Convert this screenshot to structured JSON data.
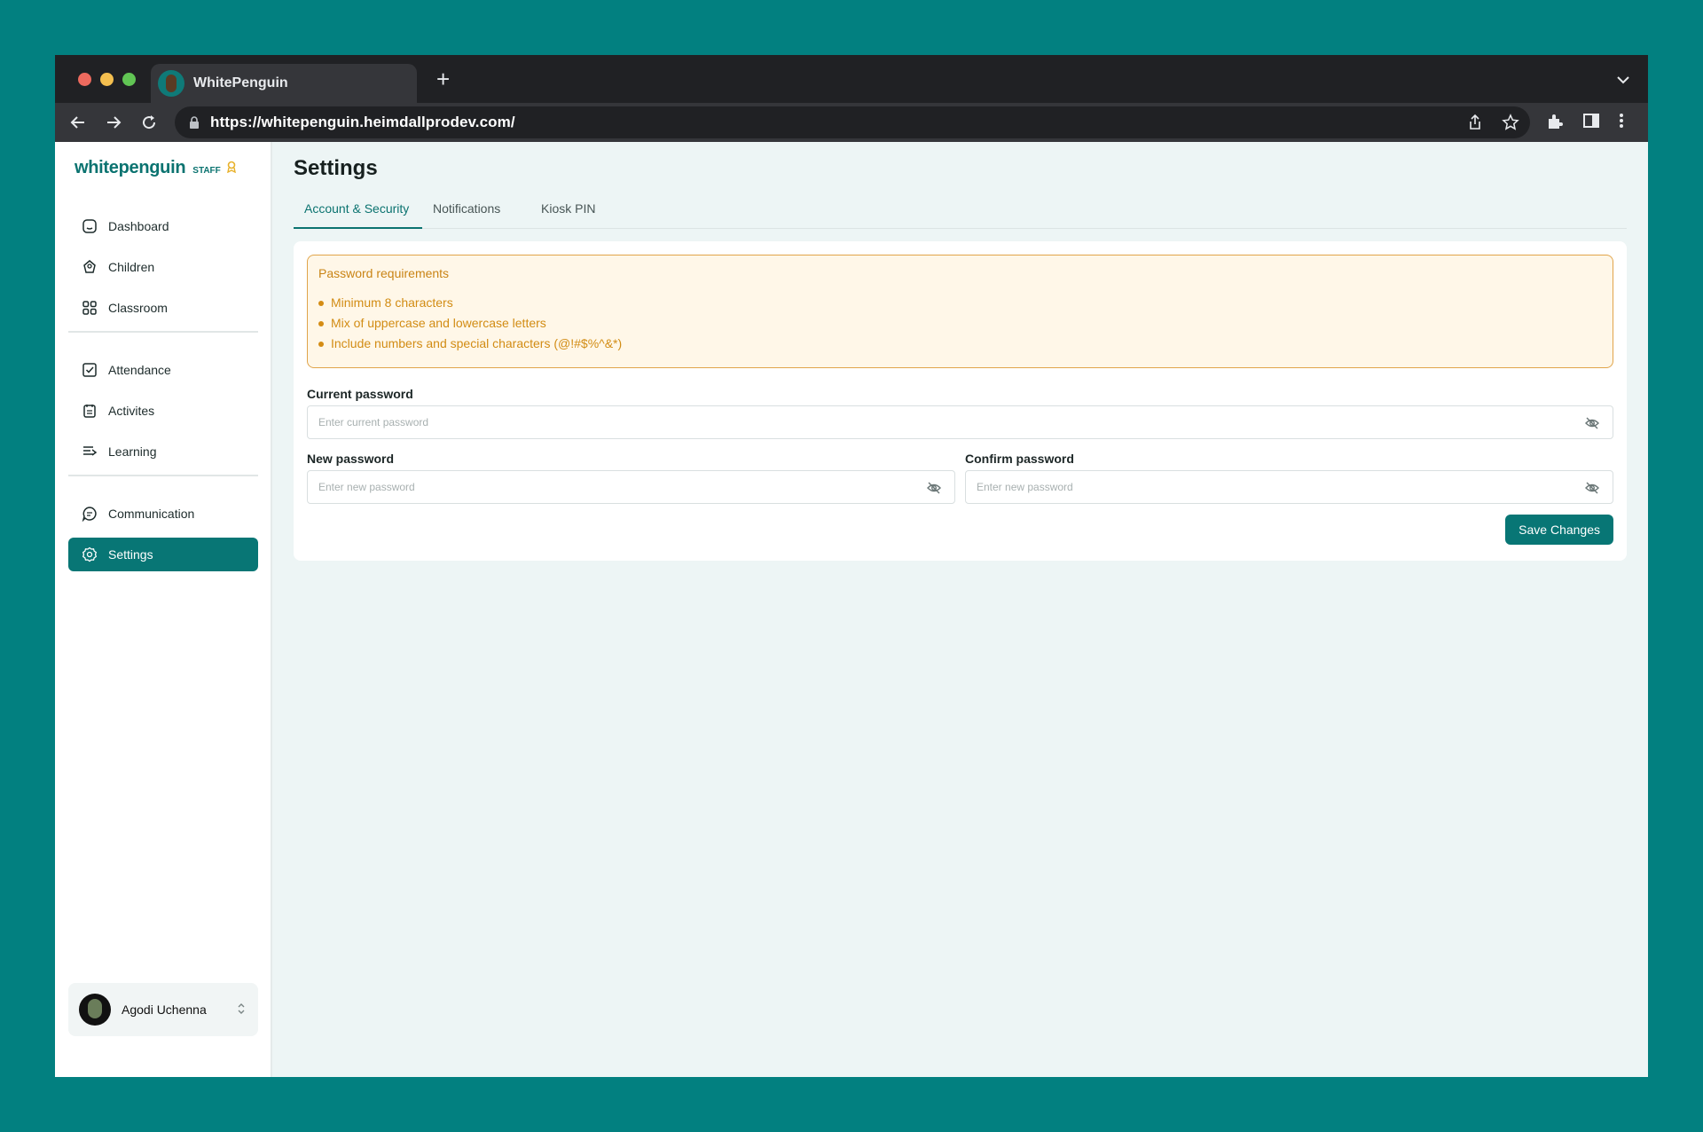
{
  "browser": {
    "tab_title": "WhitePenguin",
    "url": "https://whitepenguin.heimdallprodev.com/"
  },
  "brand": {
    "name": "whitepenguin",
    "badge": "STAFF"
  },
  "sidebar": {
    "items": [
      {
        "label": "Dashboard",
        "icon": "dashboard-icon"
      },
      {
        "label": "Children",
        "icon": "children-icon"
      },
      {
        "label": "Classroom",
        "icon": "classroom-icon"
      },
      {
        "label": "Attendance",
        "icon": "attendance-icon"
      },
      {
        "label": "Activites",
        "icon": "activities-icon"
      },
      {
        "label": "Learning",
        "icon": "learning-icon"
      },
      {
        "label": "Communication",
        "icon": "communication-icon"
      },
      {
        "label": "Settings",
        "icon": "gear-icon"
      }
    ],
    "active": "Settings"
  },
  "user": {
    "name": "Agodi Uchenna"
  },
  "page": {
    "title": "Settings",
    "tabs": [
      "Account & Security",
      "Notifications",
      "Kiosk PIN"
    ],
    "active_tab": "Account & Security"
  },
  "requirements": {
    "title": "Password requirements",
    "items": [
      "Minimum 8 characters",
      "Mix of uppercase and lowercase letters",
      "Include numbers and special characters (@!#$%^&*)"
    ]
  },
  "form": {
    "current_label": "Current password",
    "current_placeholder": "Enter current password",
    "new_label": "New password",
    "new_placeholder": "Enter new password",
    "confirm_label": "Confirm password",
    "confirm_placeholder": "Enter new password",
    "save_label": "Save Changes"
  },
  "colors": {
    "accent": "#087675",
    "page_bg": "#028080",
    "warning": "#d28c14"
  }
}
